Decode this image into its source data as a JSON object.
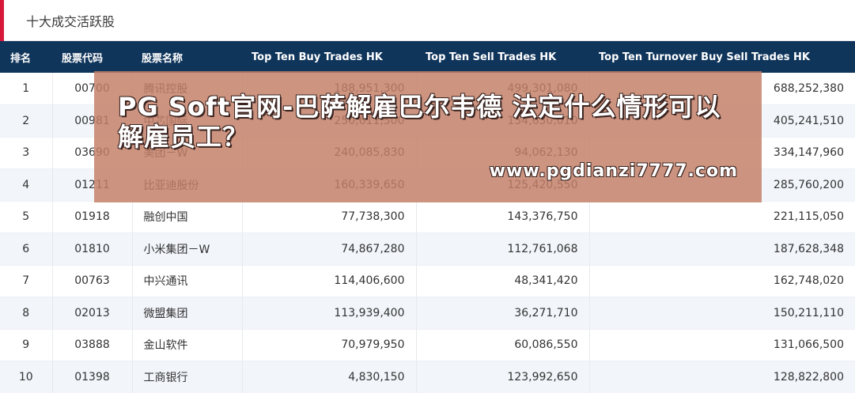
{
  "section": {
    "title": "十大成交活跃股"
  },
  "colors": {
    "accent": "#d6173a",
    "header_bg": "#10355b",
    "overlay": "#c48068"
  },
  "table": {
    "headers": [
      "排名",
      "股票代码",
      "股票名称",
      "Top Ten Buy Trades HK",
      "Top Ten Sell Trades HK",
      "Top Ten Turnover Buy Sell Trades HK"
    ],
    "rows": [
      [
        "1",
        "00700",
        "腾讯控股",
        "188,951,300",
        "499,301,080",
        "688,252,380"
      ],
      [
        "2",
        "00981",
        "中芯国际",
        "250,611,500",
        "154,630,010",
        "405,241,510"
      ],
      [
        "3",
        "03690",
        "美团－W",
        "240,085,830",
        "94,062,130",
        "334,147,960"
      ],
      [
        "4",
        "01211",
        "比亚迪股份",
        "160,339,650",
        "125,420,550",
        "285,760,200"
      ],
      [
        "5",
        "01918",
        "融创中国",
        "77,738,300",
        "143,376,750",
        "221,115,050"
      ],
      [
        "6",
        "01810",
        "小米集团－W",
        "74,867,280",
        "112,761,068",
        "187,628,348"
      ],
      [
        "7",
        "00763",
        "中兴通讯",
        "114,406,600",
        "48,341,420",
        "162,748,020"
      ],
      [
        "8",
        "02013",
        "微盟集团",
        "113,939,400",
        "36,271,710",
        "150,211,110"
      ],
      [
        "9",
        "03888",
        "金山软件",
        "70,979,950",
        "60,086,550",
        "131,066,500"
      ],
      [
        "10",
        "01398",
        "工商银行",
        "4,830,150",
        "123,992,650",
        "128,822,800"
      ]
    ]
  },
  "overlay": {
    "title": "PG Soft官网-巴萨解雇巴尔韦德 法定什么情形可以解雇员工？",
    "url": "www.pgdianzi7777.com"
  }
}
